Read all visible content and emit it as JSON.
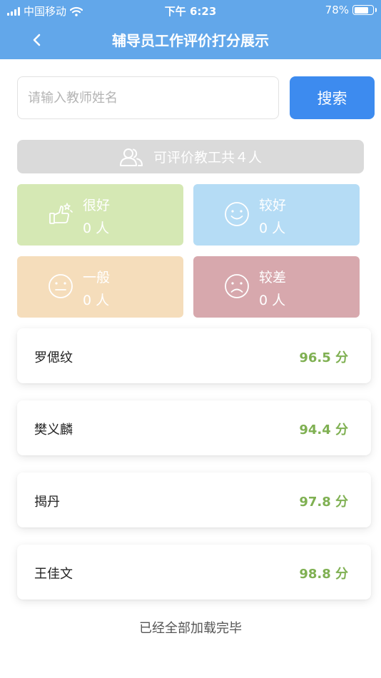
{
  "status_bar": {
    "carrier": "中国移动",
    "time": "下午 6:23",
    "battery_percent": "78%",
    "battery_level": 0.78,
    "signal_bars": 4
  },
  "nav": {
    "title": "辅导员工作评价打分展示",
    "back_icon": "chevron-left-icon"
  },
  "search": {
    "placeholder": "请输入教师姓名",
    "value": "",
    "button_label": "搜索"
  },
  "summary": {
    "icon": "people-icon",
    "text": "可评价教工共４人"
  },
  "categories": [
    {
      "label": "很好",
      "count": "0 人",
      "icon": "thumbs-up-icon",
      "color": "#d5e8b4"
    },
    {
      "label": "较好",
      "count": "0 人",
      "icon": "smile-face-icon",
      "color": "#b5dcf5"
    },
    {
      "label": "一般",
      "count": "0 人",
      "icon": "neutral-face-icon",
      "color": "#f5ddbb"
    },
    {
      "label": "较差",
      "count": "0 人",
      "icon": "sad-face-icon",
      "color": "#d7a8ad"
    }
  ],
  "teachers": [
    {
      "name": "罗偲纹",
      "score": "96.5 分"
    },
    {
      "name": "樊义麟",
      "score": "94.4 分"
    },
    {
      "name": "揭丹",
      "score": "97.8 分"
    },
    {
      "name": "王佳文",
      "score": "98.8 分"
    }
  ],
  "footer": {
    "text": "已经全部加载完毕"
  },
  "colors": {
    "header": "#62a7ea",
    "search_button": "#3d8bef",
    "score": "#7fb052",
    "summary_bar": "#dadada"
  }
}
